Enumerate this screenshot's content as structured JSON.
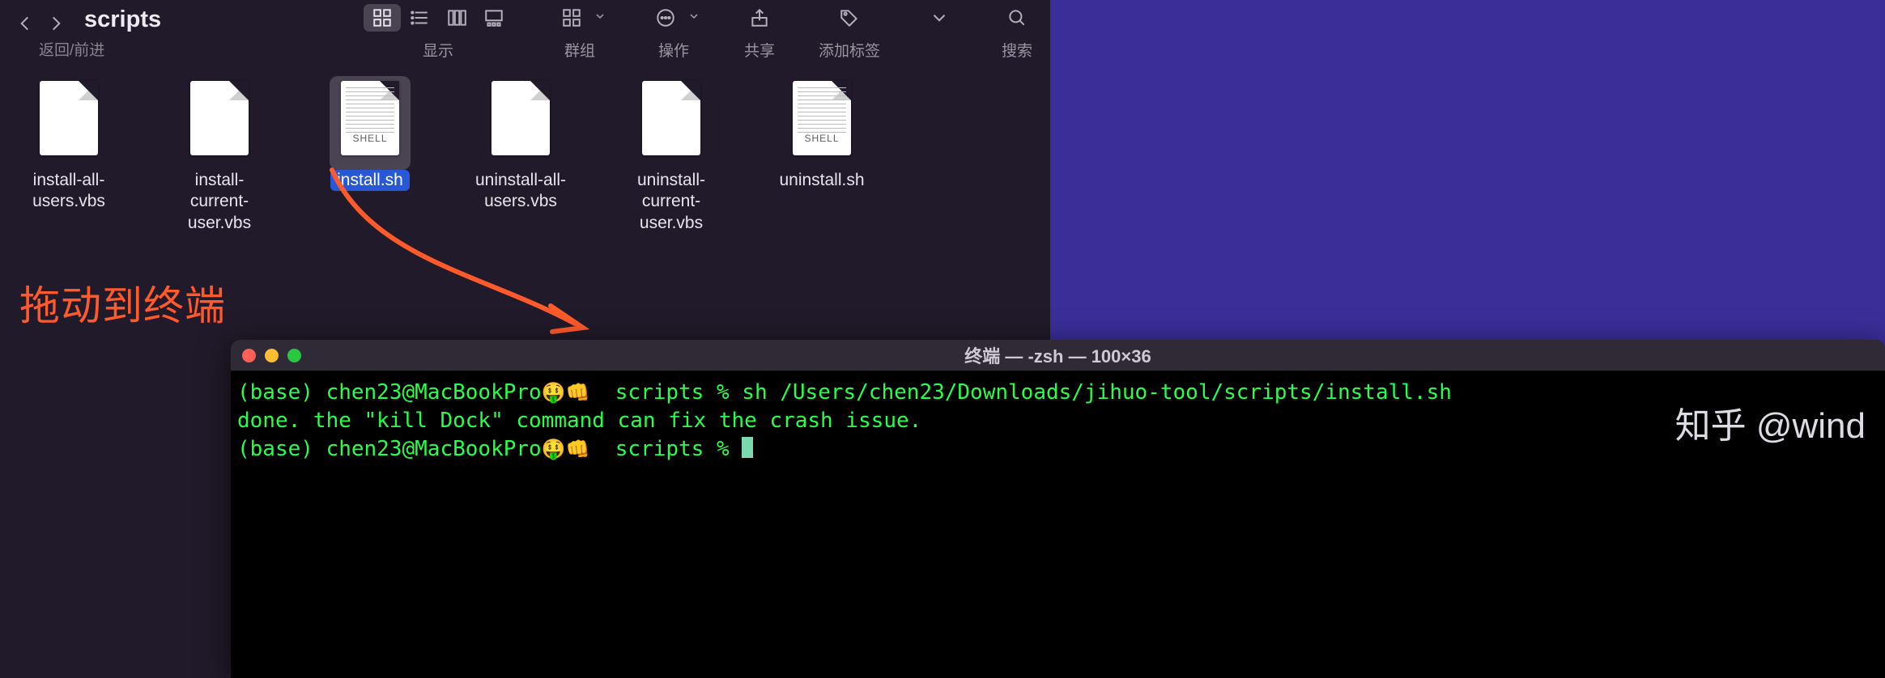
{
  "finder": {
    "folder_title": "scripts",
    "nav_sub": "返回/前进",
    "groups": {
      "view_label": "显示",
      "group_label": "群组",
      "action_label": "操作",
      "share_label": "共享",
      "tag_label": "添加标签",
      "search_label": "搜索"
    },
    "files": [
      {
        "name": "install-all-users.vbs",
        "kind": "blank",
        "selected": false
      },
      {
        "name": "install-current-user.vbs",
        "kind": "blank",
        "selected": false
      },
      {
        "name": "install.sh",
        "kind": "shell",
        "selected": true
      },
      {
        "name": "uninstall-all-users.vbs",
        "kind": "blank",
        "selected": false
      },
      {
        "name": "uninstall-current-user.vbs",
        "kind": "blank",
        "selected": false
      },
      {
        "name": "uninstall.sh",
        "kind": "shell",
        "selected": false
      }
    ],
    "shell_tag": "SHELL"
  },
  "annotation": "拖动到终端",
  "terminal": {
    "title": "终端 — -zsh — 100×36",
    "line1_prefix": "(base) chen23@MacBookPro",
    "line1_dir": "scripts",
    "line1_cmd": "sh /Users/chen23/Downloads/jihuo-tool/scripts/install.sh",
    "line2": "done. the \"kill Dock\" command can fix the crash issue.",
    "line3_prefix": "(base) chen23@MacBookPro",
    "line3_dir": "scripts",
    "prompt_emoji": "🤑👊",
    "prompt_symbol": "%"
  },
  "watermark": "知乎 @wind"
}
